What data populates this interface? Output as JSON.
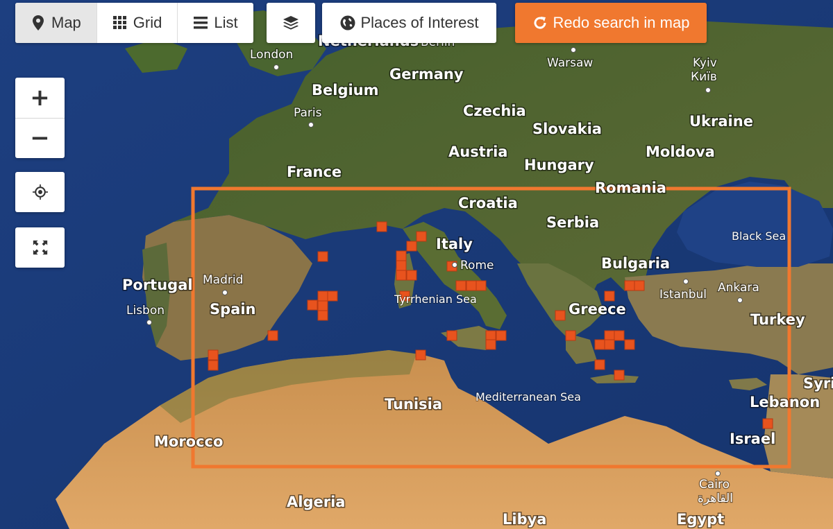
{
  "toolbar": {
    "views": [
      {
        "label": "Map",
        "icon": "map-pin-icon",
        "active": true
      },
      {
        "label": "Grid",
        "icon": "grid-icon",
        "active": false
      },
      {
        "label": "List",
        "icon": "list-icon",
        "active": false
      }
    ],
    "layers_icon": "layers-icon",
    "places_of_interest": {
      "label": "Places of Interest",
      "icon": "globe-icon"
    },
    "redo_search": {
      "label": "Redo search in map",
      "icon": "refresh-icon",
      "color": "#f0782f"
    }
  },
  "map_controls": {
    "zoom_in": "+",
    "zoom_out": "−",
    "locate_icon": "crosshair-icon",
    "fullscreen_icon": "expand-icon"
  },
  "map": {
    "search_area_color": "#f0782f",
    "marker_color": "#e8531e",
    "labels": {
      "countries": {
        "netherlands": "Netherlands",
        "germany": "Germany",
        "belgium": "Belgium",
        "czechia": "Czechia",
        "slovakia": "Slovakia",
        "ukraine": "Ukraine",
        "austria": "Austria",
        "moldova": "Moldova",
        "france": "France",
        "hungary": "Hungary",
        "romania": "Romania",
        "croatia": "Croatia",
        "serbia": "Serbia",
        "italy": "Italy",
        "bulgaria": "Bulgaria",
        "portugal": "Portugal",
        "spain": "Spain",
        "greece": "Greece",
        "turkey": "Turkey",
        "tunisia": "Tunisia",
        "morocco": "Morocco",
        "algeria": "Algeria",
        "libya": "Libya",
        "egypt": "Egypt",
        "lebanon": "Lebanon",
        "israel": "Israel",
        "syria": "Syri"
      },
      "cities": {
        "london": "London",
        "berlin": "Berlin",
        "warsaw": "Warsaw",
        "kyiv": "Kyiv",
        "kyiv_local": "Київ",
        "paris": "Paris",
        "madrid": "Madrid",
        "lisbon": "Lisbon",
        "rome": "Rome",
        "istanbul": "Istanbul",
        "ankara": "Ankara",
        "cairo": "Cairo",
        "cairo_local": "القاهرة"
      },
      "seas": {
        "black_sea": "Black Sea",
        "tyrrhenian_sea": "Tyrrhenian Sea",
        "mediterranean_sea": "Mediterranean Sea"
      }
    }
  }
}
